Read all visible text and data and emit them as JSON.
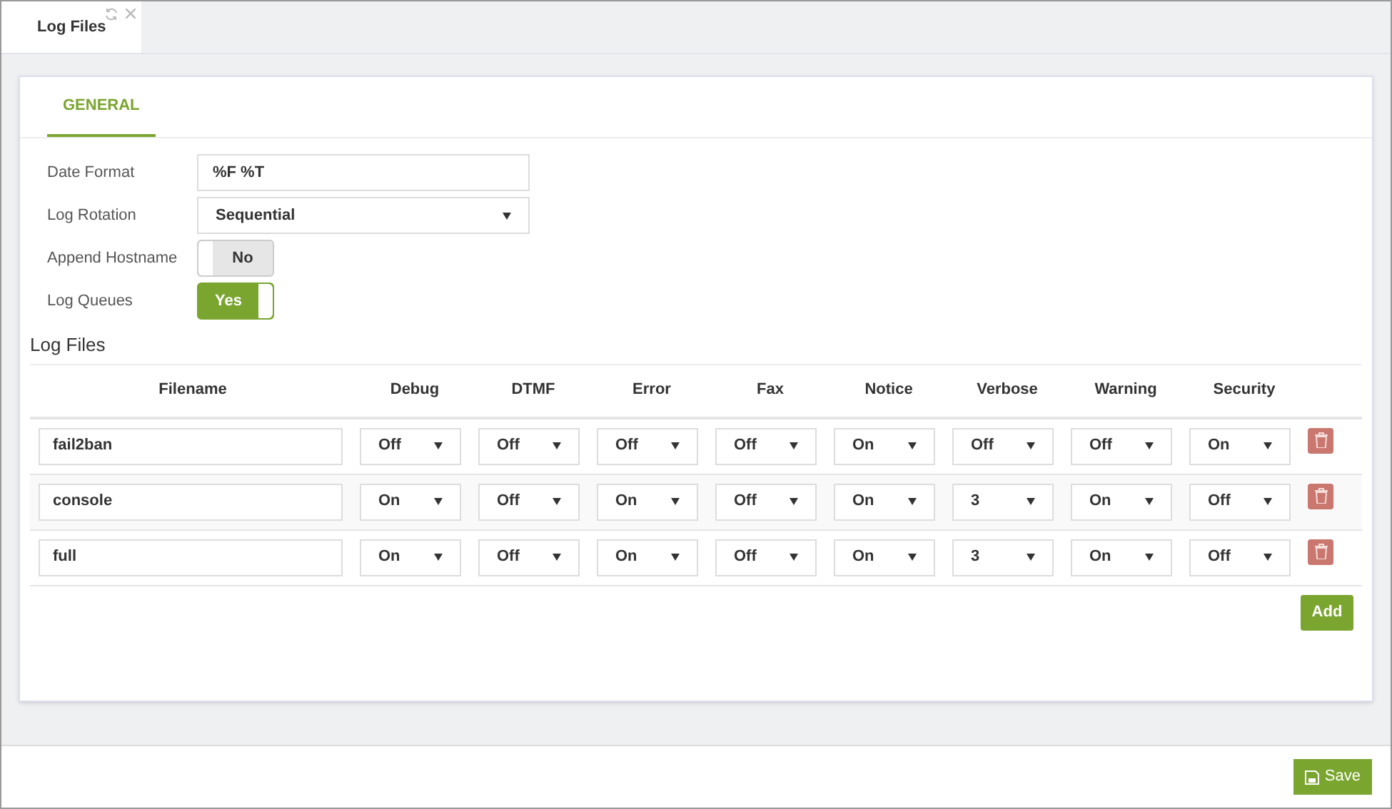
{
  "tabs": [
    {
      "label": "Log Files",
      "selected": true
    }
  ],
  "section_tabs": [
    {
      "label": "GENERAL",
      "selected": true
    }
  ],
  "form": [
    {
      "kind": "text",
      "label": "Date Format",
      "value": "%F %T"
    },
    {
      "kind": "select",
      "label": "Log Rotation",
      "value": "Sequential"
    },
    {
      "kind": "toggle",
      "label": "Append Hostname",
      "value": "No",
      "on": false
    },
    {
      "kind": "toggle",
      "label": "Log Queues",
      "value": "Yes",
      "on": true
    }
  ],
  "log_files": {
    "title": "Log Files",
    "columns": [
      "Filename",
      "Debug",
      "DTMF",
      "Error",
      "Fax",
      "Notice",
      "Verbose",
      "Warning",
      "Security"
    ],
    "rows": [
      {
        "filename": "fail2ban",
        "levels": [
          "Off",
          "Off",
          "Off",
          "Off",
          "On",
          "Off",
          "Off",
          "On"
        ]
      },
      {
        "filename": "console",
        "levels": [
          "On",
          "Off",
          "On",
          "Off",
          "On",
          "3",
          "On",
          "Off"
        ]
      },
      {
        "filename": "full",
        "levels": [
          "On",
          "Off",
          "On",
          "Off",
          "On",
          "3",
          "On",
          "Off"
        ]
      }
    ],
    "add_button": "Add"
  },
  "save_button": "Save"
}
